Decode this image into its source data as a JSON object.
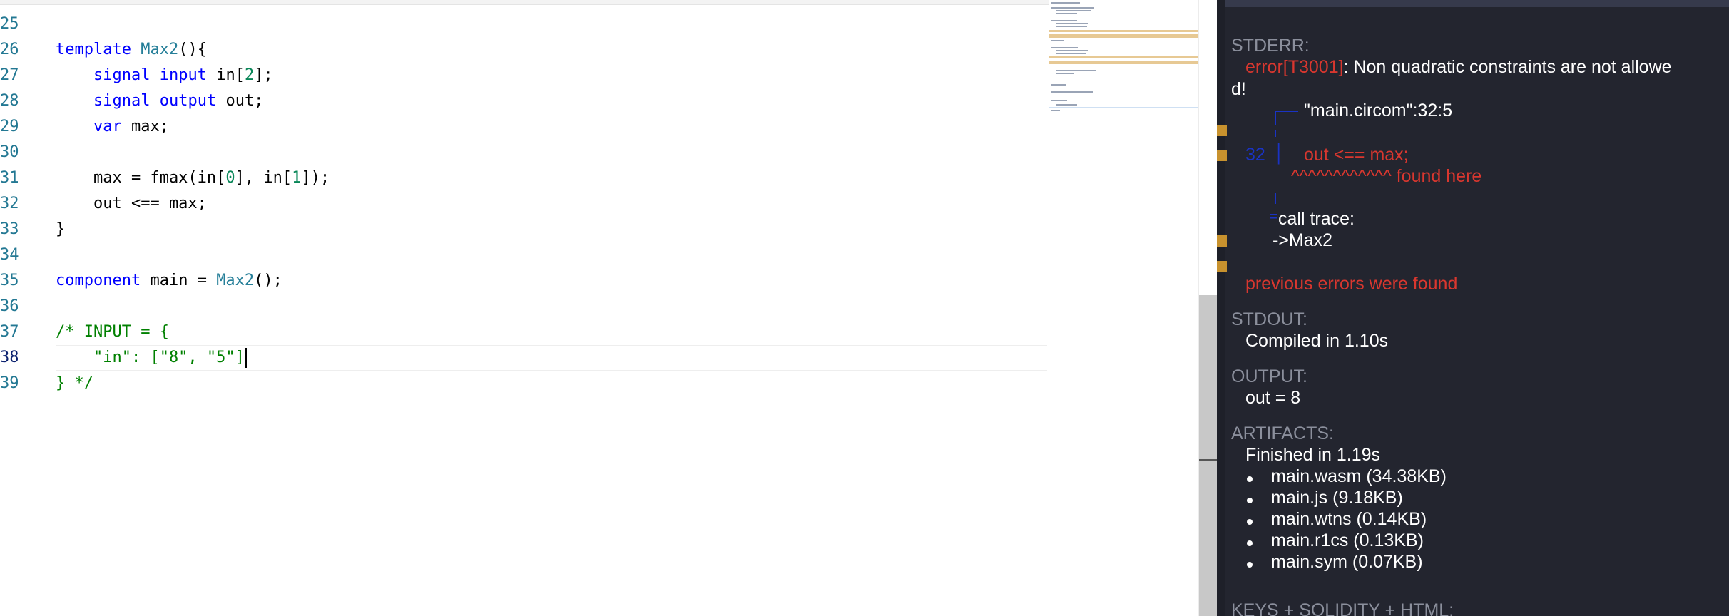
{
  "editor": {
    "lines": [
      {
        "n": "25",
        "segs": []
      },
      {
        "n": "26",
        "segs": [
          {
            "t": "template ",
            "c": "kw"
          },
          {
            "t": "Max2",
            "c": "ty"
          },
          {
            "t": "(){",
            "c": ""
          }
        ]
      },
      {
        "n": "27",
        "segs": [
          {
            "t": "    ",
            "c": ""
          },
          {
            "t": "signal",
            "c": "kw"
          },
          {
            "t": " ",
            "c": ""
          },
          {
            "t": "input",
            "c": "kw"
          },
          {
            "t": " in[",
            "c": ""
          },
          {
            "t": "2",
            "c": "num"
          },
          {
            "t": "];",
            "c": ""
          }
        ],
        "guide": true
      },
      {
        "n": "28",
        "segs": [
          {
            "t": "    ",
            "c": ""
          },
          {
            "t": "signal",
            "c": "kw"
          },
          {
            "t": " ",
            "c": ""
          },
          {
            "t": "output",
            "c": "kw"
          },
          {
            "t": " out;",
            "c": ""
          }
        ],
        "guide": true
      },
      {
        "n": "29",
        "segs": [
          {
            "t": "    ",
            "c": ""
          },
          {
            "t": "var",
            "c": "kw"
          },
          {
            "t": " max;",
            "c": ""
          }
        ],
        "guide": true
      },
      {
        "n": "30",
        "segs": [],
        "guide": true
      },
      {
        "n": "31",
        "segs": [
          {
            "t": "    max = fmax(in[",
            "c": ""
          },
          {
            "t": "0",
            "c": "num"
          },
          {
            "t": "], in[",
            "c": ""
          },
          {
            "t": "1",
            "c": "num"
          },
          {
            "t": "]);",
            "c": ""
          }
        ],
        "guide": true
      },
      {
        "n": "32",
        "segs": [
          {
            "t": "    out <== max;",
            "c": ""
          }
        ],
        "guide": true
      },
      {
        "n": "33",
        "segs": [
          {
            "t": "}",
            "c": ""
          }
        ]
      },
      {
        "n": "34",
        "segs": []
      },
      {
        "n": "35",
        "segs": [
          {
            "t": "component",
            "c": "kw"
          },
          {
            "t": " main = ",
            "c": ""
          },
          {
            "t": "Max2",
            "c": "ty"
          },
          {
            "t": "();",
            "c": ""
          }
        ]
      },
      {
        "n": "36",
        "segs": []
      },
      {
        "n": "37",
        "segs": [
          {
            "t": "/* INPUT = {",
            "c": "cm"
          }
        ]
      },
      {
        "n": "38",
        "segs": [
          {
            "t": "    \"in\": [\"8\", \"5\"]",
            "c": "cm"
          }
        ],
        "guide": true,
        "current": true
      },
      {
        "n": "39",
        "segs": [
          {
            "t": "} */",
            "c": "cm"
          }
        ]
      }
    ]
  },
  "panel": {
    "stderr_label": "STDERR:",
    "error_code": "error[T3001]",
    "error_msg_1": ": Non quadratic constraints are not allowe",
    "error_msg_2": "d!",
    "file_ref": "\"main.circom\":32:5",
    "line_num": "32",
    "line_pipe": "│",
    "code_snippet": "out <== max;",
    "carets": "^^^^^^^^^^^^ found here",
    "eq_sign": "=",
    "call_trace": "call trace:",
    "trace_item": "->Max2",
    "prev_errors": "previous errors were found",
    "stdout_label": "STDOUT:",
    "compiled": "Compiled in 1.10s",
    "output_label": "OUTPUT:",
    "output_value": "out = 8",
    "artifacts_label": "ARTIFACTS:",
    "finished": "Finished in 1.19s",
    "artifacts": [
      "main.wasm (34.38KB)",
      "main.js (9.18KB)",
      "main.wtns (0.14KB)",
      "main.r1cs (0.13KB)",
      "main.sym (0.07KB)"
    ],
    "next_label": "KEYS + SOLIDITY + HTML:"
  },
  "colors": {
    "keyword": "#0000ff",
    "type": "#267f99",
    "number": "#098658",
    "comment": "#008000",
    "panel_bg": "#23252f",
    "error_red": "#d9372f",
    "marker": "#c8922e"
  }
}
